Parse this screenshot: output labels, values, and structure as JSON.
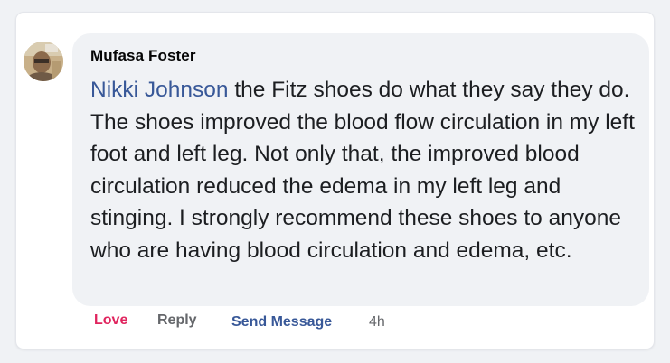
{
  "comment": {
    "author": "Mufasa Foster",
    "mention": "Nikki Johnson",
    "text": " the Fitz shoes do what they say they do. The shoes improved the blood flow circulation in my left foot and left leg. Not only that, the improved blood circulation reduced the edema in my left leg and stinging. I strongly recommend these shoes to anyone who are having blood circulation and edema, etc."
  },
  "actions": {
    "love": "Love",
    "reply": "Reply",
    "send_message": "Send Message",
    "time": "4h"
  },
  "colors": {
    "mention": "#385898",
    "love": "#e0245e",
    "muted": "#65676b",
    "bubble": "#f0f2f5"
  },
  "icons": {
    "avatar": "user-avatar"
  }
}
